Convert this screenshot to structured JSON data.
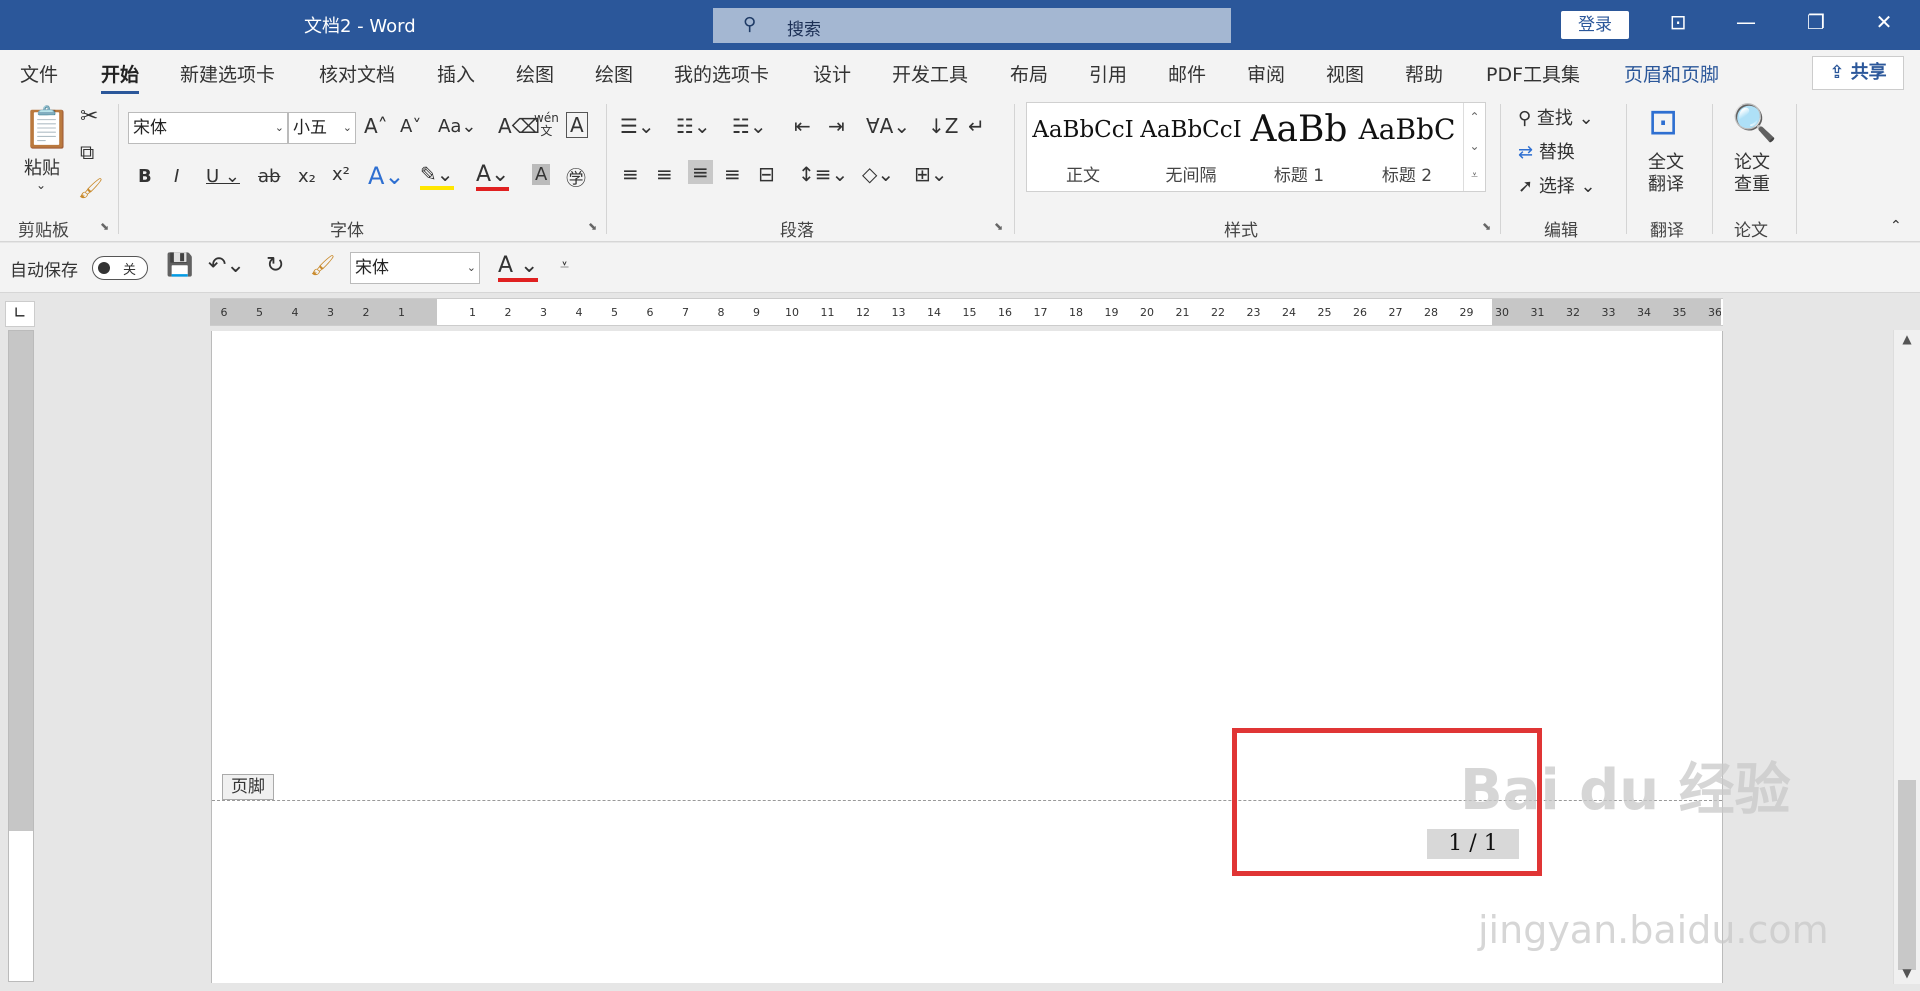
{
  "titlebar": {
    "title": "文档2  -  Word",
    "search_placeholder": "搜索",
    "login": "登录"
  },
  "menu": {
    "tabs": [
      "文件",
      "开始",
      "新建选项卡",
      "核对文档",
      "插入",
      "绘图",
      "绘图",
      "我的选项卡",
      "设计",
      "开发工具",
      "布局",
      "引用",
      "邮件",
      "审阅",
      "视图",
      "帮助",
      "PDF工具集",
      "页眉和页脚"
    ],
    "active": "开始",
    "share": "共享"
  },
  "ribbon": {
    "clipboard": {
      "paste": "粘贴",
      "label": "剪贴板"
    },
    "font": {
      "name": "宋体",
      "size": "小五",
      "label": "字体"
    },
    "paragraph": {
      "label": "段落"
    },
    "styles": {
      "label": "样式",
      "items": [
        {
          "preview": "AaBbCcI",
          "name": "正文"
        },
        {
          "preview": "AaBbCcI",
          "name": "无间隔"
        },
        {
          "preview": "AaBb",
          "name": "标题 1"
        },
        {
          "preview": "AaBbC",
          "name": "标题 2"
        }
      ]
    },
    "editing": {
      "find": "查找",
      "replace": "替换",
      "select": "选择",
      "label": "编辑"
    },
    "translate": {
      "button": "全文翻译",
      "label": "翻译"
    },
    "paper": {
      "button": "论文查重",
      "label": "论文"
    }
  },
  "qat": {
    "autosave": "自动保存",
    "autosave_state": "关",
    "font": "宋体"
  },
  "document": {
    "footer_tag": "页脚",
    "page_number": "1 / 1"
  },
  "watermark": {
    "brand": "Bai du 经验",
    "url": "jingyan.baidu.com"
  },
  "colors": {
    "brand": "#2b579a",
    "highlight_box": "#e03535"
  }
}
